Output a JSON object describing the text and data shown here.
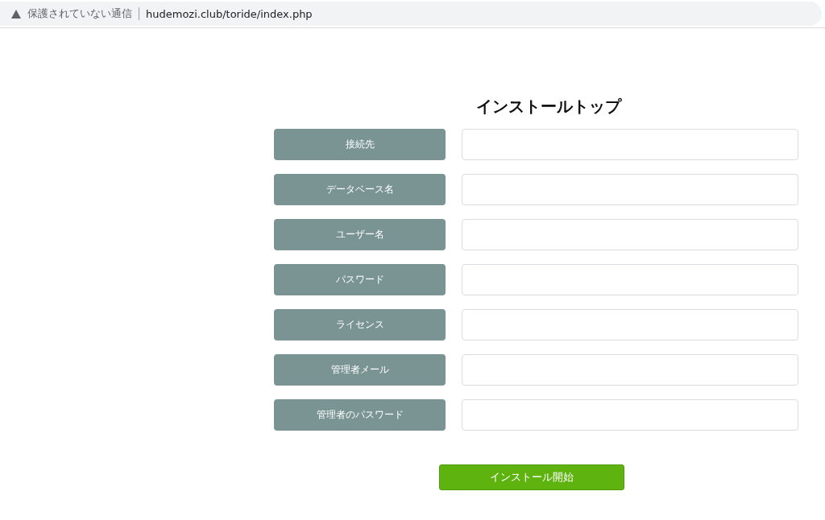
{
  "address_bar": {
    "security": "保護されていない通信",
    "url": "hudemozi.club/toride/index.php"
  },
  "title": "インストールトップ",
  "fields": [
    {
      "label": "接続先"
    },
    {
      "label": "データベース名"
    },
    {
      "label": "ユーザー名"
    },
    {
      "label": "パスワード"
    },
    {
      "label": "ライセンス"
    },
    {
      "label": "管理者メール"
    },
    {
      "label": "管理者のパスワード"
    }
  ],
  "submit": "インストール開始"
}
